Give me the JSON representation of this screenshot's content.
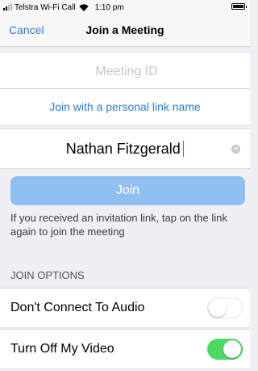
{
  "status_bar": {
    "carrier": "Telstra Wi-Fi Call",
    "time": "1:10 pm",
    "signal_bars": 2,
    "battery_level": 1.0
  },
  "nav": {
    "cancel_label": "Cancel",
    "title": "Join a Meeting"
  },
  "meeting_id": {
    "placeholder": "Meeting ID",
    "value": ""
  },
  "personal_link_label": "Join with a personal link name",
  "name_field": {
    "value": "Nathan Fitzgerald"
  },
  "join_button_label": "Join",
  "hint_text": "If you received an invitation link, tap on the link again to join the meeting",
  "join_options": {
    "header": "JOIN OPTIONS",
    "items": [
      {
        "label": "Don't Connect To Audio",
        "enabled": false
      },
      {
        "label": "Turn Off My Video",
        "enabled": true
      }
    ]
  },
  "colors": {
    "accent": "#2d7bd6",
    "join_button": "#8fbff3",
    "toggle_on": "#4cd964"
  }
}
